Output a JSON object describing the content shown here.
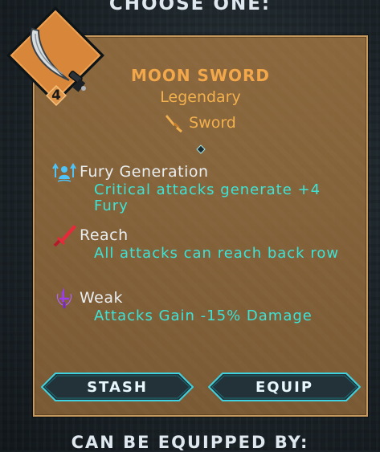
{
  "header": {
    "title": "CHOOSE ONE:"
  },
  "item": {
    "level": "4",
    "name": "MOON SWORD",
    "rarity": "Legendary",
    "type": "Sword",
    "icon": "curved-sword-icon"
  },
  "traits": [
    {
      "icon": "fury-generation-icon",
      "name": "Fury Generation",
      "description": "Critical attacks generate +4 Fury"
    },
    {
      "icon": "reach-icon",
      "name": "Reach",
      "description": "All attacks can reach back row"
    },
    {
      "icon": "weak-icon",
      "name": "Weak",
      "description": "Attacks Gain -15% Damage"
    }
  ],
  "actions": {
    "stash_label": "STASH",
    "equip_label": "EQUIP"
  },
  "footer": {
    "equipped_by_label": "CAN BE EQUIPPED BY:"
  },
  "colors": {
    "card_bg": "#966e3e",
    "item_name": "#f2a74a",
    "trait_desc": "#3ee3d6",
    "button_border": "#3fd2e0"
  }
}
